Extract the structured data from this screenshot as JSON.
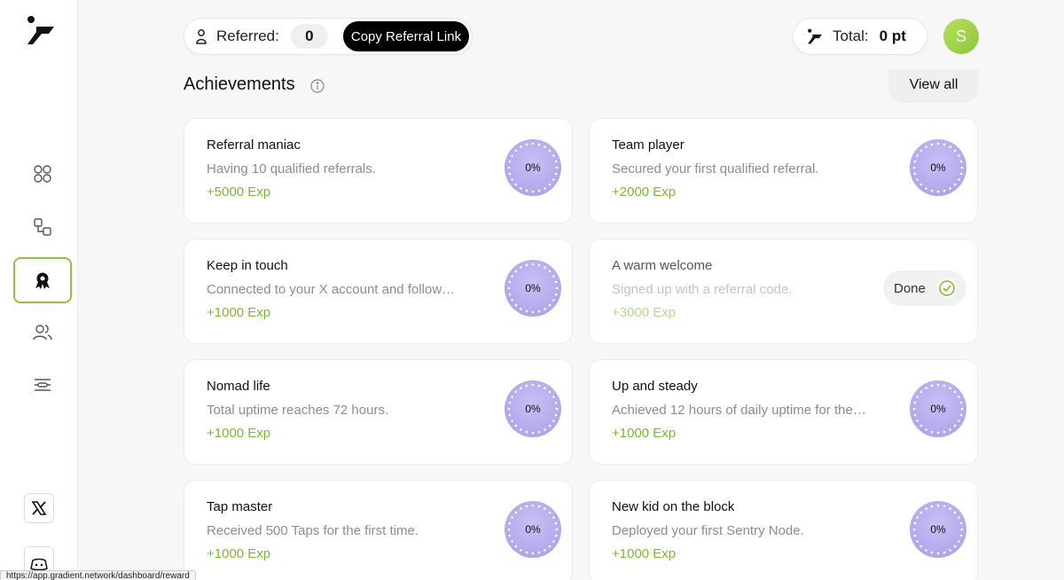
{
  "header": {
    "referred_label": "Referred:",
    "referred_count": "0",
    "copy_button": "Copy Referral Link",
    "total_label": "Total:",
    "total_value": "0 pt",
    "avatar_initial": "S"
  },
  "section": {
    "title": "Achievements",
    "view_all": "View all"
  },
  "sidebar": {
    "items": [
      {
        "icon": "grid-icon"
      },
      {
        "icon": "nodes-icon"
      },
      {
        "icon": "award-icon",
        "active": true
      },
      {
        "icon": "users-icon"
      },
      {
        "icon": "sliders-icon"
      }
    ],
    "social": [
      {
        "icon": "x-icon"
      },
      {
        "icon": "discord-icon"
      }
    ]
  },
  "achievements": [
    {
      "title": "Referral maniac",
      "desc": "Having 10 qualified referrals.",
      "exp": "+5000 Exp",
      "progress": "0%"
    },
    {
      "title": "Team player",
      "desc": "Secured your first qualified referral.",
      "exp": "+2000 Exp",
      "progress": "0%"
    },
    {
      "title": "Keep in touch",
      "desc": "Connected to your X account and follow…",
      "exp": "+1000 Exp",
      "progress": "0%"
    },
    {
      "title": "A warm welcome",
      "desc": "Signed up with a referral code.",
      "exp": "+3000 Exp",
      "status": "Done"
    },
    {
      "title": "Nomad life",
      "desc": "Total uptime reaches 72 hours.",
      "exp": "+1000 Exp",
      "progress": "0%"
    },
    {
      "title": "Up and steady",
      "desc": "Achieved 12 hours of daily uptime for the…",
      "exp": "+1000 Exp",
      "progress": "0%"
    },
    {
      "title": "Tap master",
      "desc": "Received 500 Taps for the first time.",
      "exp": "+1000 Exp",
      "progress": "0%"
    },
    {
      "title": "New kid on the block",
      "desc": "Deployed your first Sentry Node.",
      "exp": "+1000 Exp",
      "progress": "0%"
    }
  ],
  "status_bar": {
    "url": "https://app.gradient.network/dashboard/reward"
  },
  "colors": {
    "accent": "#8cc63f",
    "exp_green": "#7cb82f",
    "progress_purple": "#a79ce8"
  }
}
